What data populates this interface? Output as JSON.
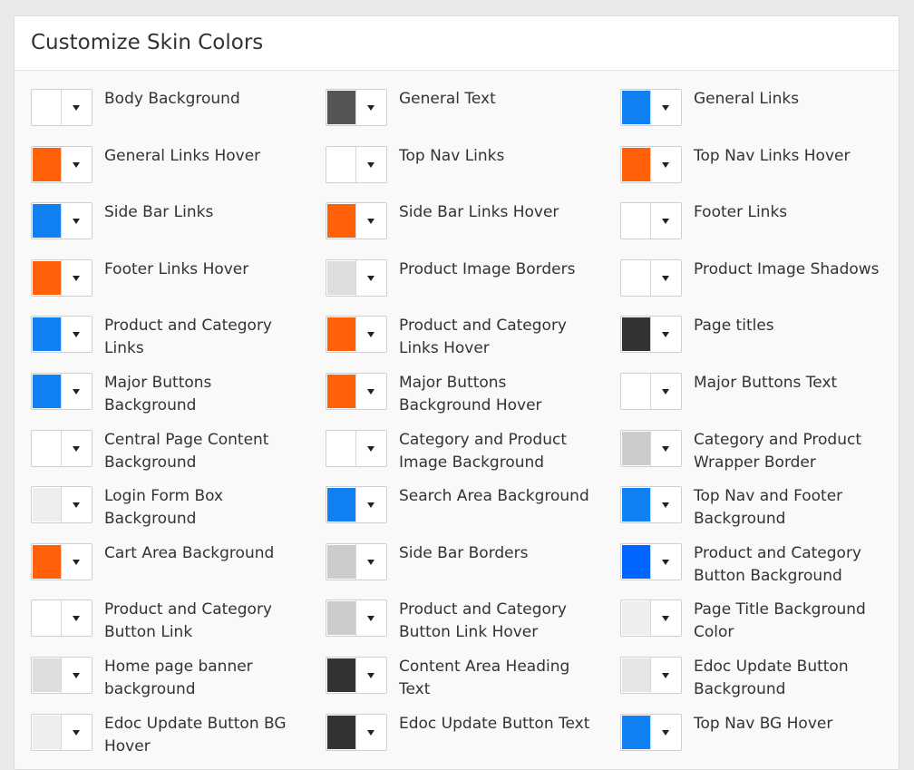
{
  "panel": {
    "title": "Customize Skin Colors"
  },
  "items": [
    {
      "label": "Body Background",
      "color": "#ffffff"
    },
    {
      "label": "General Text",
      "color": "#555555"
    },
    {
      "label": "General Links",
      "color": "#1180f2"
    },
    {
      "label": "General Links Hover",
      "color": "#ff6008"
    },
    {
      "label": "Top Nav Links",
      "color": "#ffffff"
    },
    {
      "label": "Top Nav Links Hover",
      "color": "#ff6008"
    },
    {
      "label": "Side Bar Links",
      "color": "#1180f2"
    },
    {
      "label": "Side Bar Links Hover",
      "color": "#ff6008"
    },
    {
      "label": "Footer Links",
      "color": "#ffffff"
    },
    {
      "label": "Footer Links Hover",
      "color": "#ff6008"
    },
    {
      "label": "Product Image Borders",
      "color": "#dddddd"
    },
    {
      "label": "Product Image Shadows",
      "color": "#ffffff"
    },
    {
      "label": "Product and Category Links",
      "color": "#1180f2"
    },
    {
      "label": "Product and Category Links Hover",
      "color": "#ff6008"
    },
    {
      "label": "Page titles",
      "color": "#333333"
    },
    {
      "label": "Major Buttons Background",
      "color": "#1180f2"
    },
    {
      "label": "Major Buttons Background Hover",
      "color": "#ff6008"
    },
    {
      "label": "Major Buttons Text",
      "color": "#ffffff"
    },
    {
      "label": "Central Page Content Background",
      "color": "#ffffff"
    },
    {
      "label": "Category and Product Image Background",
      "color": "#ffffff"
    },
    {
      "label": "Category and Product Wrapper Border",
      "color": "#cccccc"
    },
    {
      "label": "Login Form Box Background",
      "color": "#eeeeee"
    },
    {
      "label": "Search Area Background",
      "color": "#1180f2"
    },
    {
      "label": "Top Nav and Footer Background",
      "color": "#1180f2"
    },
    {
      "label": "Cart Area Background",
      "color": "#ff6008"
    },
    {
      "label": "Side Bar Borders",
      "color": "#cccccc"
    },
    {
      "label": "Product and Category Button Background",
      "color": "#0066ff"
    },
    {
      "label": "Product and Category Button Link",
      "color": "#ffffff"
    },
    {
      "label": "Product and Category Button Link Hover",
      "color": "#cccccc"
    },
    {
      "label": "Page Title Background Color",
      "color": "#eeeeee"
    },
    {
      "label": "Home page banner background",
      "color": "#dddddd"
    },
    {
      "label": "Content Area Heading Text",
      "color": "#333333"
    },
    {
      "label": "Edoc Update Button Background",
      "color": "#e5e5e5"
    },
    {
      "label": "Edoc Update Button BG Hover",
      "color": "#eeeeee"
    },
    {
      "label": "Edoc Update Button Text",
      "color": "#333333"
    },
    {
      "label": "Top Nav BG Hover",
      "color": "#1180f2"
    }
  ]
}
